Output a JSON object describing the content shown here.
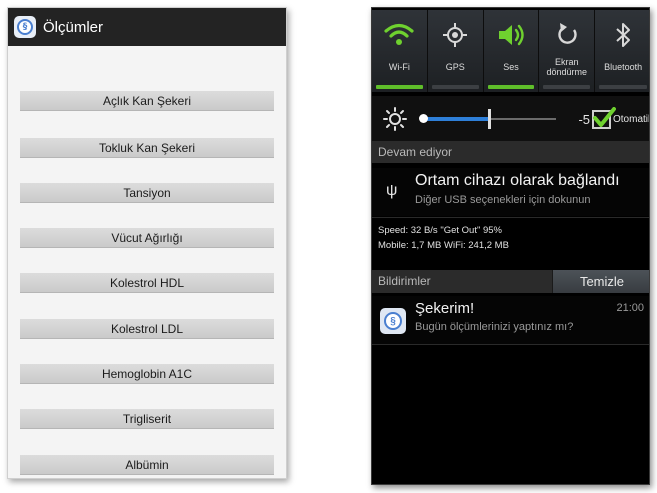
{
  "left_app": {
    "title": "Ölçümler",
    "icon": "app-logo-icon",
    "menu": [
      "Açlık Kan Şekeri",
      "Tokluk Kan Şekeri",
      "Tansiyon",
      "Vücut Ağırlığı",
      "Kolestrol HDL",
      "Kolestrol LDL",
      "Hemoglobin A1C",
      "Trigliserit",
      "Albümin"
    ]
  },
  "notification_panel": {
    "toggles": [
      {
        "label": "Wi-Fi",
        "icon": "wifi-icon",
        "on": true
      },
      {
        "label": "GPS",
        "icon": "gps-icon",
        "on": false
      },
      {
        "label": "Ses",
        "icon": "sound-icon",
        "on": true
      },
      {
        "label": "Ekran döndürme",
        "icon": "rotate-icon",
        "on": false
      },
      {
        "label": "Bluetooth",
        "icon": "bluetooth-icon",
        "on": false
      }
    ],
    "brightness": {
      "value": "-5",
      "level_fraction": 0.5,
      "auto_label": "Otomatik",
      "auto_checked": true
    },
    "ongoing_header": "Devam ediyor",
    "usb": {
      "title": "Ortam cihazı olarak bağlandı",
      "subtitle": "Diğer USB seçenekleri için dokunun"
    },
    "stats": {
      "line1": "Speed: 32 B/s  \"Get Out\" 95%",
      "line2": "Mobile: 1,7 MB   WiFi: 241,2 MB"
    },
    "notifications_header": "Bildirimler",
    "clear_label": "Temizle",
    "notification": {
      "title": "Şekerim!",
      "time": "21:00",
      "text": "Bugün ölçümlerinizi yaptınız mı?"
    },
    "colors": {
      "toggle_on": "#5fbe2a",
      "accent_blue": "#2e7fd8"
    }
  }
}
